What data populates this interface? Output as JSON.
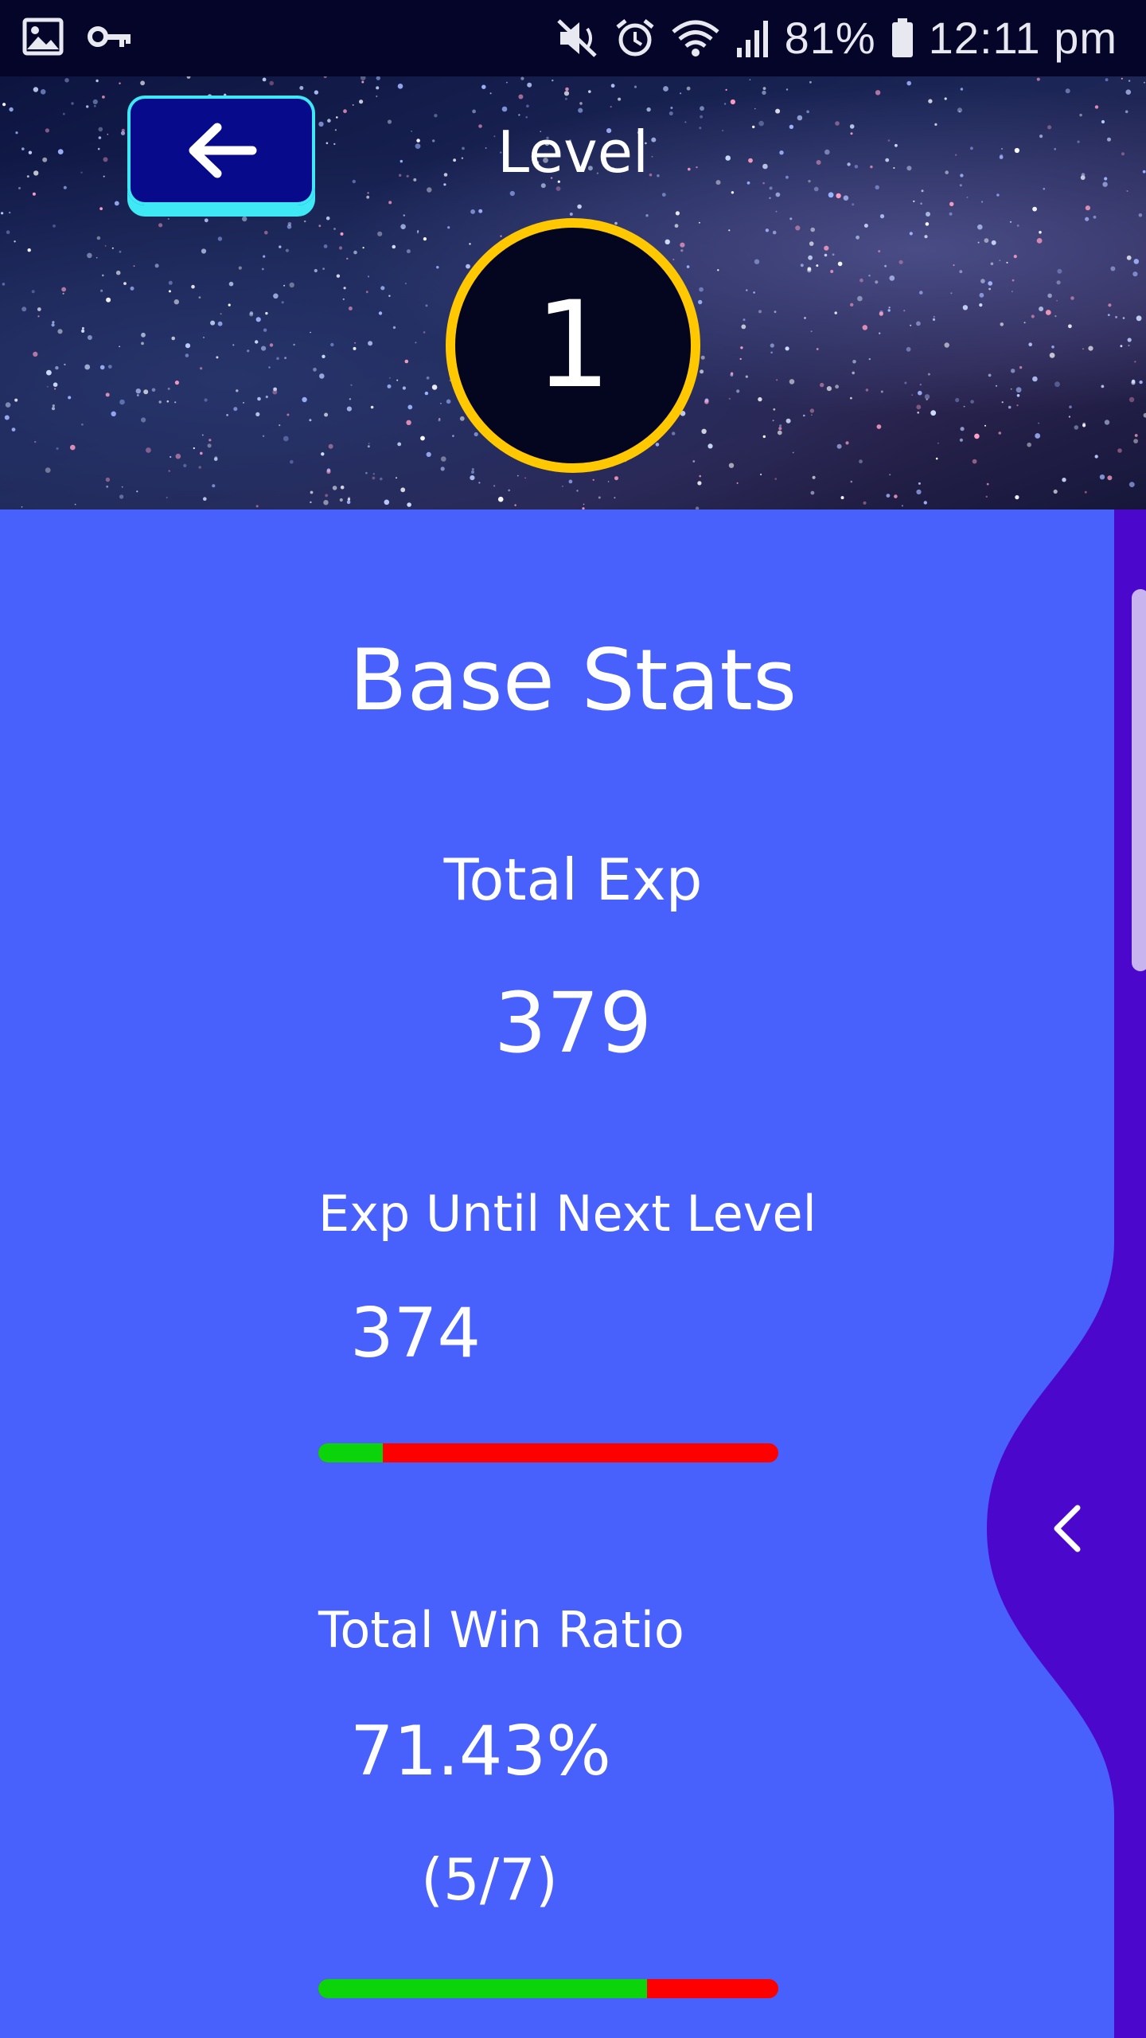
{
  "status_bar": {
    "battery_percent": "81%",
    "time": "12:11 pm",
    "icons": [
      "image-icon",
      "key-icon",
      "vibrate-mute-icon",
      "alarm-icon",
      "wifi-icon",
      "signal-icon",
      "battery-icon"
    ]
  },
  "header": {
    "back_icon": "arrow-left-icon",
    "title": "Level",
    "level": "1",
    "badge_ring_color": "#ffc800"
  },
  "stats": {
    "section_title": "Base Stats",
    "total_exp": {
      "label": "Total Exp",
      "value": "379"
    },
    "exp_until_next": {
      "label": "Exp Until Next Level",
      "value": "374",
      "progress": 0.14
    },
    "win_ratio": {
      "label": "Total Win Ratio",
      "value": "71.43%",
      "detail": "(5/7)",
      "progress": 0.7143
    }
  },
  "drawer": {
    "toggle_icon": "chevron-left-icon"
  },
  "colors": {
    "background": "#4860fc",
    "drawer": "#4c07cc",
    "progress_good": "#0bd40b",
    "progress_bad": "#ff0000",
    "back_button": "#070a8a",
    "back_button_edge": "#3fe8f5"
  }
}
